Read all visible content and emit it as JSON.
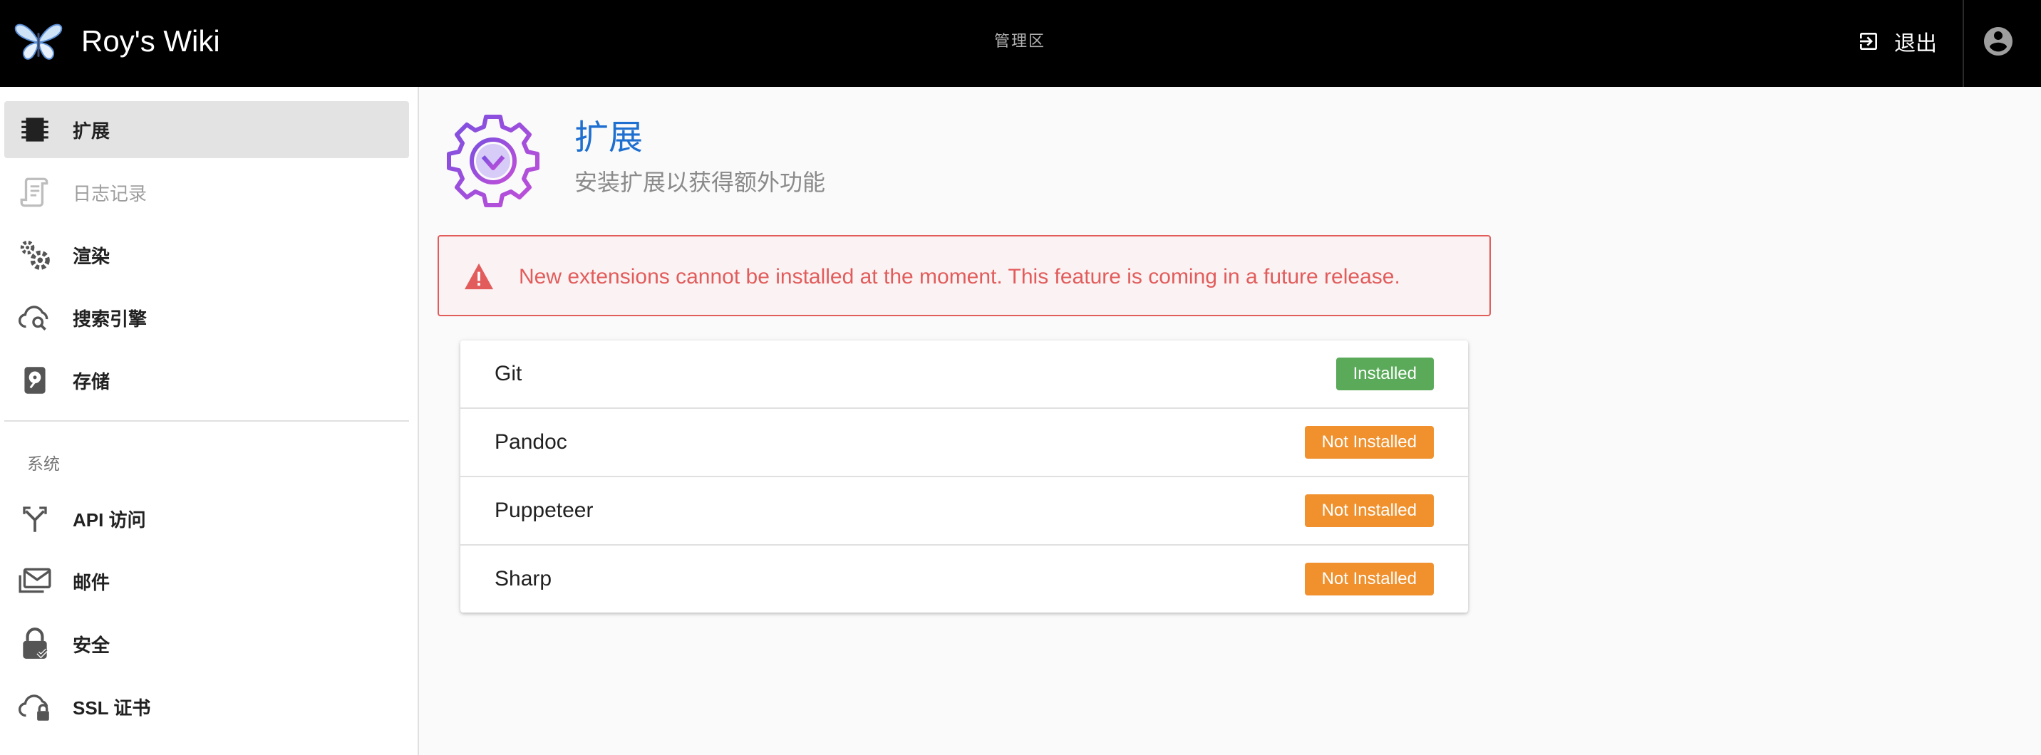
{
  "header": {
    "app_title": "Roy's Wiki",
    "area_label": "管理区",
    "logout_label": "退出",
    "logo_icon": "butterfly-logo",
    "account_icon": "account-circle-icon"
  },
  "sidebar": {
    "items": [
      {
        "label": "扩展",
        "icon": "chip-icon",
        "active": true
      },
      {
        "label": "日志记录",
        "icon": "script-icon",
        "disabled": true
      },
      {
        "label": "渲染",
        "icon": "cogs-icon"
      },
      {
        "label": "搜索引擎",
        "icon": "cloud-search-icon"
      },
      {
        "label": "存储",
        "icon": "harddisk-icon"
      }
    ],
    "section_header": "系统",
    "system_items": [
      {
        "label": "API 访问",
        "icon": "api-fork-icon"
      },
      {
        "label": "邮件",
        "icon": "mail-icon"
      },
      {
        "label": "安全",
        "icon": "lock-check-icon"
      },
      {
        "label": "SSL 证书",
        "icon": "cloud-lock-icon"
      }
    ]
  },
  "main": {
    "title": "扩展",
    "subtitle": "安装扩展以获得额外功能",
    "alert": "New extensions cannot be installed at the moment. This feature is coming in a future release.",
    "extensions": [
      {
        "name": "Git",
        "status": "Installed",
        "state": "installed"
      },
      {
        "name": "Pandoc",
        "status": "Not Installed",
        "state": "not-installed"
      },
      {
        "name": "Puppeteer",
        "status": "Not Installed",
        "state": "not-installed"
      },
      {
        "name": "Sharp",
        "status": "Not Installed",
        "state": "not-installed"
      }
    ]
  },
  "colors": {
    "header_bg": "#000000",
    "accent": "#1e6fd0",
    "alert": "#e25c5c",
    "installed": "#5aaa5a",
    "not_installed": "#f0912e"
  }
}
